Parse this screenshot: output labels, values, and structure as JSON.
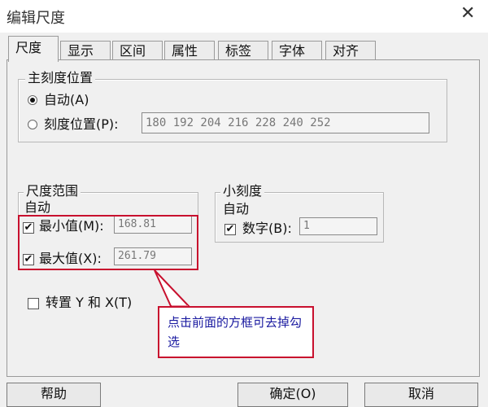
{
  "window": {
    "title": "编辑尺度",
    "close_glyph": "✕"
  },
  "tabs": [
    {
      "label": "尺度",
      "active": true
    },
    {
      "label": "显示"
    },
    {
      "label": "区间"
    },
    {
      "label": "属性"
    },
    {
      "label": "标签"
    },
    {
      "label": "字体"
    },
    {
      "label": "对齐"
    }
  ],
  "major_tick": {
    "group_title": "主刻度位置",
    "auto_label": "自动(A)",
    "positions_label": "刻度位置(P):",
    "positions_value": "180 192 204 216 228 240 252",
    "selected": "auto"
  },
  "range": {
    "group_title": "尺度范围",
    "auto_caption": "自动",
    "min_label": "最小值(M):",
    "min_value": "168.81",
    "min_checked": true,
    "max_label": "最大值(X):",
    "max_value": "261.79",
    "max_checked": true
  },
  "minor_tick": {
    "group_title": "小刻度",
    "auto_caption": "自动",
    "number_label": "数字(B):",
    "number_value": "1",
    "number_checked": true
  },
  "transpose": {
    "label": "转置 Y 和 X(T)",
    "checked": false
  },
  "annotation": {
    "text": "点击前面的方框可去掉勾选"
  },
  "buttons": {
    "help": "帮助",
    "ok": "确定(O)",
    "cancel": "取消"
  },
  "colors": {
    "annotation_border": "#c8102e",
    "annotation_text": "#1a1aa0"
  }
}
